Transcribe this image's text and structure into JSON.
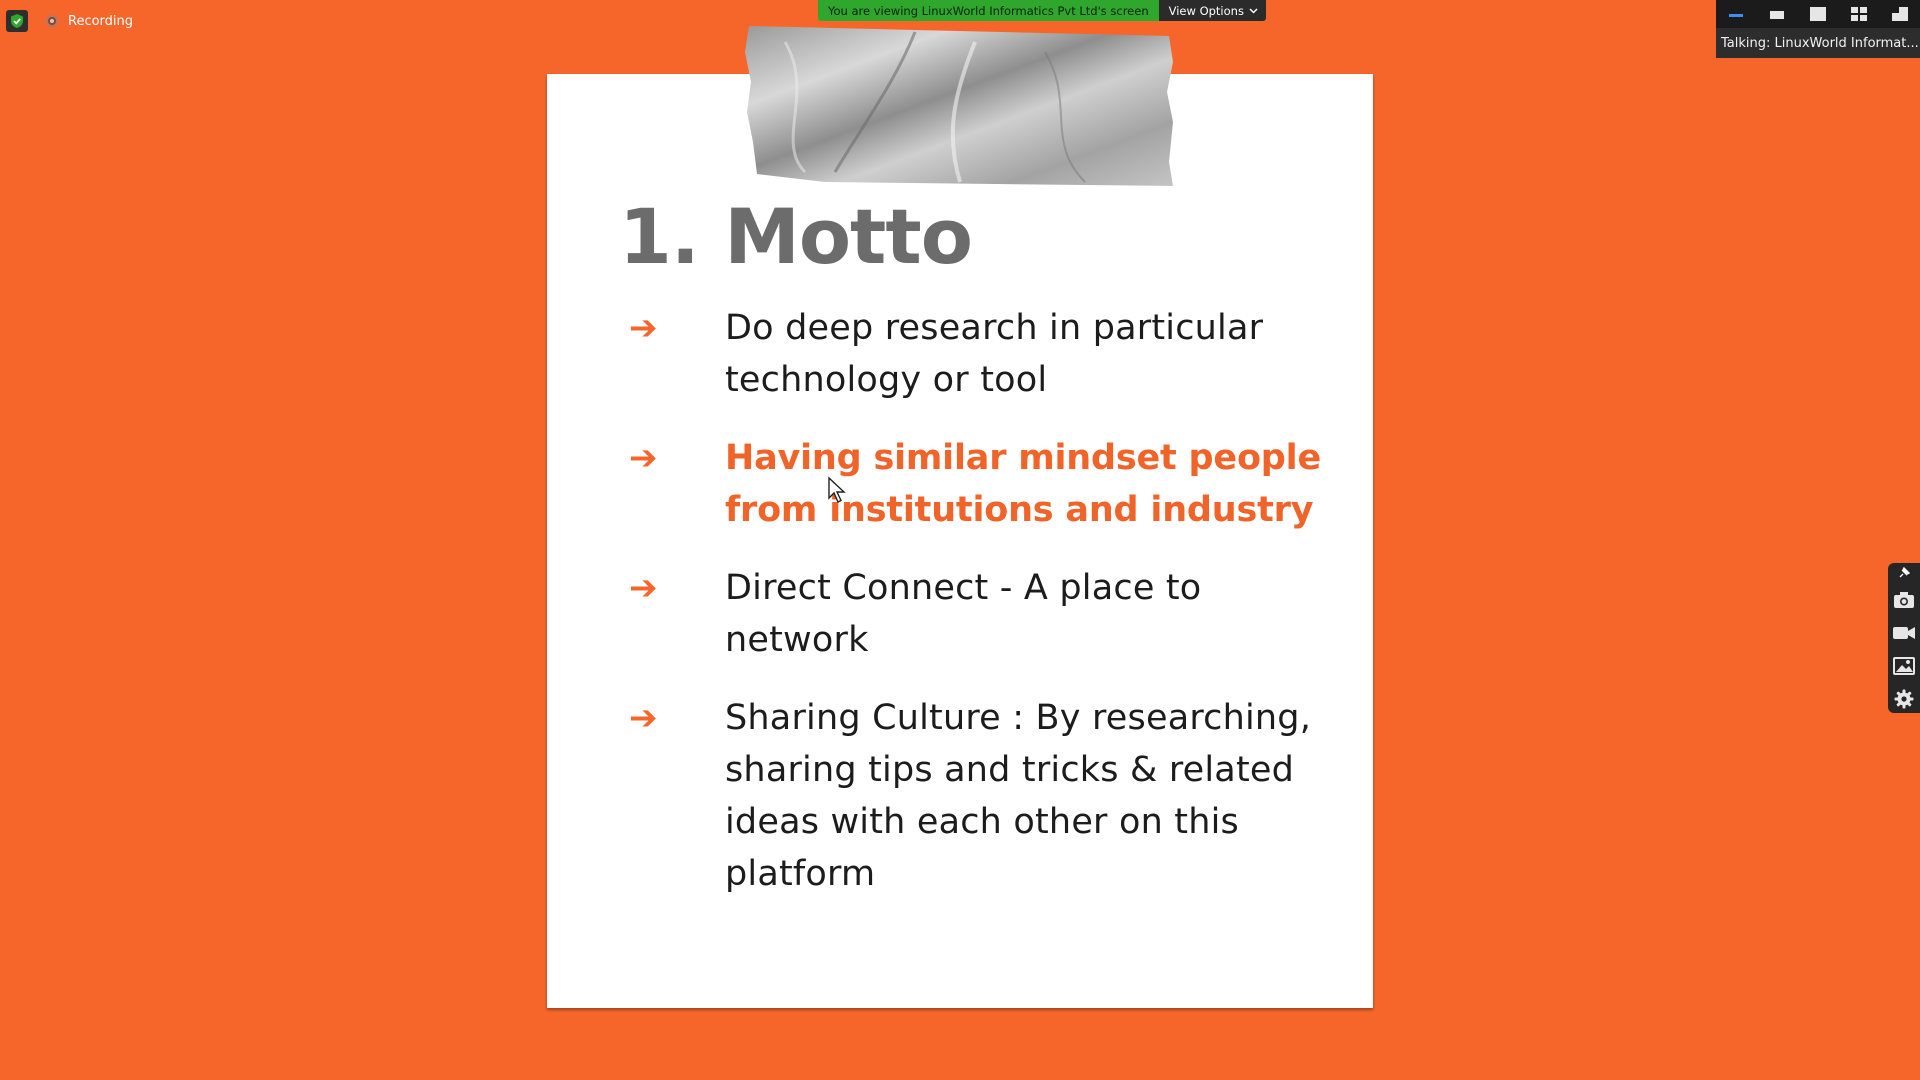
{
  "meeting": {
    "recording_label": "Recording",
    "share_banner_text": "You are viewing LinuxWorld Informatics Pvt Ltd's screen",
    "view_options_label": "View Options",
    "talking_text": "Talking: LinuxWorld Informat..."
  },
  "slide": {
    "title": "1. Motto",
    "bullets": [
      {
        "text": "Do deep research in particular technology or tool",
        "highlighted": false
      },
      {
        "text": "Having similar mindset people from institutions and industry",
        "highlighted": true
      },
      {
        "text": "Direct Connect - A place to network",
        "highlighted": false
      },
      {
        "text": "Sharing Culture : By researching, sharing tips and tricks & related ideas with each other on this platform",
        "highlighted": false
      }
    ]
  },
  "icons": {
    "security": "shield-check-icon",
    "arrow": "right-arrow-icon",
    "side_toolbar": [
      "pin-icon",
      "camera-icon",
      "video-icon",
      "image-icon",
      "gear-icon"
    ],
    "layouts": [
      "minimize-layout-icon",
      "thumbnail-layout-icon",
      "speaker-layout-icon",
      "gallery-layout-icon",
      "exit-fullscreen-icon"
    ]
  },
  "colors": {
    "background": "#f6662b",
    "slide_accent": "#f06329",
    "title_gray": "#6c6c6c",
    "banner_green": "#2ea72c"
  }
}
